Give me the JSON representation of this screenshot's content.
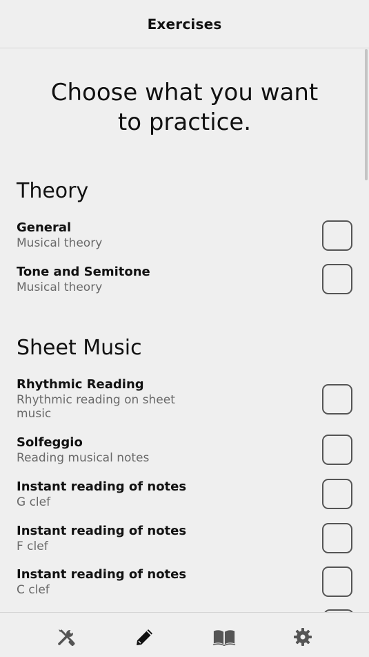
{
  "header": {
    "title": "Exercises"
  },
  "intro": {
    "line1": "Choose what you want",
    "line2": "to practice."
  },
  "sections": [
    {
      "title": "Theory",
      "items": [
        {
          "title": "General",
          "subtitle": "Musical theory",
          "checked": false
        },
        {
          "title": "Tone and Semitone",
          "subtitle": "Musical theory",
          "checked": false
        }
      ]
    },
    {
      "title": "Sheet Music",
      "items": [
        {
          "title": "Rhythmic Reading",
          "subtitle": "Rhythmic reading on sheet music",
          "checked": false
        },
        {
          "title": "Solfeggio",
          "subtitle": "Reading musical notes",
          "checked": false
        },
        {
          "title": "Instant reading of notes",
          "subtitle": "G clef",
          "checked": false
        },
        {
          "title": "Instant reading of notes",
          "subtitle": "F clef",
          "checked": false
        },
        {
          "title": "Instant reading of notes",
          "subtitle": "C clef",
          "checked": false
        }
      ]
    }
  ],
  "tabbar": {
    "tabs": [
      {
        "icon": "tools-icon",
        "active": false
      },
      {
        "icon": "pencil-icon",
        "active": true
      },
      {
        "icon": "book-icon",
        "active": false
      },
      {
        "icon": "gear-icon",
        "active": false
      }
    ]
  },
  "colors": {
    "background": "#efefef",
    "text": "#111111",
    "subtitle": "#6a6a6a",
    "divider": "#d6d6d6",
    "icon": "#555555"
  }
}
